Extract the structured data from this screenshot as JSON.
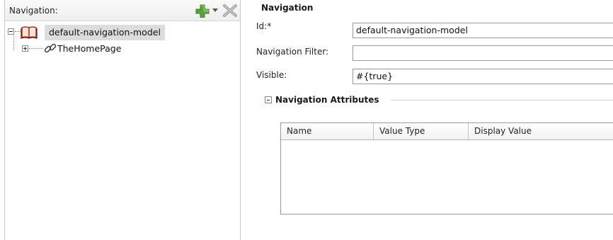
{
  "left_panel": {
    "title": "Navigation:",
    "tree": {
      "root_label": "default-navigation-model",
      "children": [
        {
          "label": "TheHomePage"
        }
      ]
    }
  },
  "form": {
    "section_title": "Navigation",
    "id_label": "Id:*",
    "id_value": "default-navigation-model",
    "filter_label": "Navigation Filter:",
    "filter_value": "",
    "visible_label": "Visible:",
    "visible_value": "#{true}"
  },
  "attributes": {
    "title": "Navigation Attributes",
    "columns": [
      "Name",
      "Value Type",
      "Display Value"
    ],
    "rows": []
  },
  "colors": {
    "add_icon": "#5aa33a",
    "delete_icon": "#9a9a9a",
    "selection": "#dcdcdc"
  }
}
